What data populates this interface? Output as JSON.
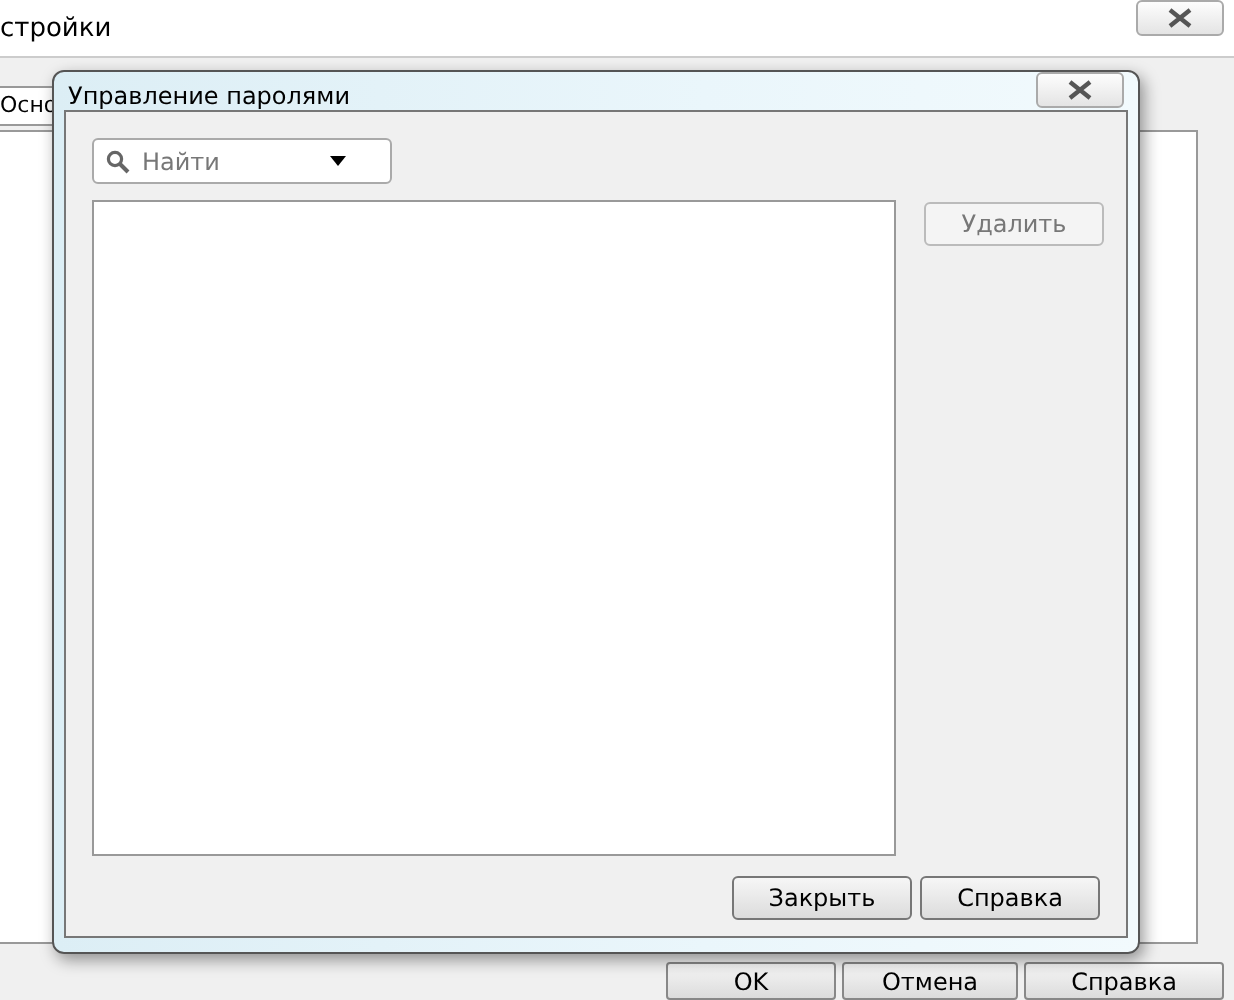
{
  "background_window": {
    "title": "стройки",
    "tab": "Осно",
    "buttons": [
      "OK",
      "Отмена",
      "Справка"
    ]
  },
  "dialog": {
    "title": "Управление паролями",
    "search": {
      "placeholder": "Найти"
    },
    "delete_button": {
      "label": "Удалить",
      "disabled": true
    },
    "buttons": [
      "Закрыть",
      "Справка"
    ]
  }
}
